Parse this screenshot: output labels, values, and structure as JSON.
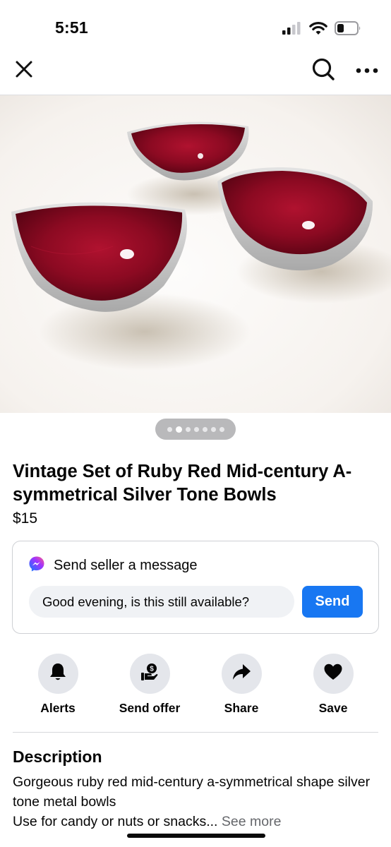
{
  "status_bar": {
    "time": "5:51",
    "icons": [
      "signal-icon",
      "wifi-icon",
      "battery-icon"
    ]
  },
  "nav": {
    "icons": [
      "close-icon",
      "search-icon",
      "more-icon"
    ]
  },
  "listing": {
    "photo_count": 7,
    "active_photo_index": 1,
    "title": "Vintage Set of Ruby Red Mid-century A-symmetrical Silver Tone Bowls",
    "price": "$15"
  },
  "message": {
    "header": "Send seller a message",
    "input_value": "Good evening, is this still available?",
    "send_label": "Send",
    "icon": "messenger-icon"
  },
  "actions": [
    {
      "label": "Alerts",
      "icon": "bell-icon"
    },
    {
      "label": "Send offer",
      "icon": "offer-icon"
    },
    {
      "label": "Share",
      "icon": "share-icon"
    },
    {
      "label": "Save",
      "icon": "heart-icon"
    }
  ],
  "description": {
    "heading": "Description",
    "line1": "Gorgeous ruby red mid-century a-symmetrical shape silver tone metal bowls",
    "line2": "Use for candy or nuts or snacks...",
    "see_more": "See more"
  },
  "colors": {
    "accent": "#1877f2",
    "muted_text": "#65676b",
    "chip_bg": "#e4e6eb",
    "ruby": "#8e0b22"
  }
}
